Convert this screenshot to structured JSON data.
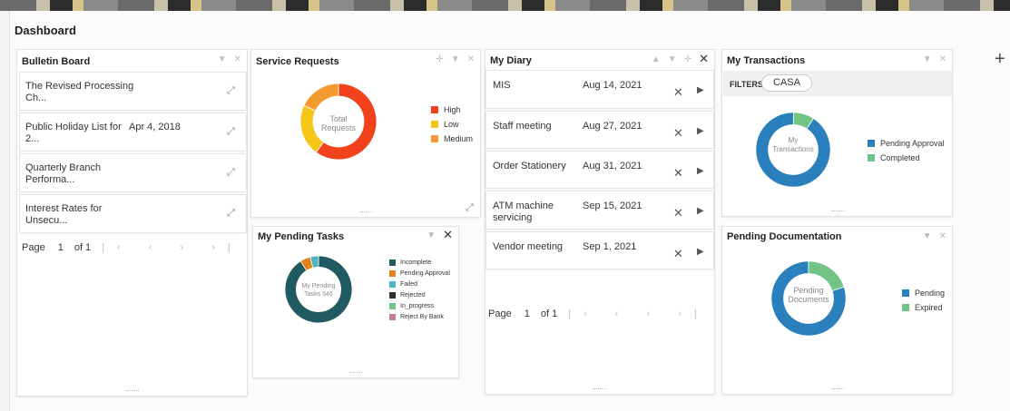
{
  "page": {
    "title": "Dashboard",
    "add_icon": "plus-icon"
  },
  "colors": {
    "high": "#f2421b",
    "low": "#f5c518",
    "medium": "#f49b30",
    "teal": "#205b62",
    "orange": "#e4831c",
    "cyan": "#4cb6c4",
    "blue": "#2a7fbd",
    "green": "#72c386",
    "pink": "#c77f93",
    "black": "#2e2e2e"
  },
  "bulletin": {
    "title": "Bulletin Board",
    "items": [
      {
        "text": "The Revised Processing Ch...",
        "date": ""
      },
      {
        "text": "Public Holiday List for 2...",
        "date": "Apr 4, 2018"
      },
      {
        "text": "Quarterly Branch Performa...",
        "date": ""
      },
      {
        "text": "Interest Rates for Unsecu...",
        "date": ""
      }
    ],
    "pager": {
      "label": "Page",
      "current": "1",
      "of": "of 1"
    }
  },
  "service": {
    "title": "Service Requests",
    "center_label": "Total Requests",
    "legend": [
      "High",
      "Low",
      "Medium"
    ]
  },
  "pending_tasks": {
    "title": "My Pending Tasks",
    "center_label": "My Pending Tasks 546",
    "legend": [
      "Incomplete",
      "Pending Approval",
      "Failed",
      "Rejected",
      "In_progress",
      "Reject By Bank"
    ]
  },
  "diary": {
    "title": "My Diary",
    "rows": [
      {
        "name": "MIS",
        "date": "Aug 14, 2021"
      },
      {
        "name": "Staff meeting",
        "date": "Aug 27, 2021"
      },
      {
        "name": "Order Stationery",
        "date": "Aug 31, 2021"
      },
      {
        "name": "ATM machine servicing",
        "date": "Sep 15, 2021"
      },
      {
        "name": "Vendor meeting",
        "date": "Sep 1, 2021"
      }
    ],
    "pager": {
      "label": "Page",
      "current": "1",
      "of": "of 1"
    }
  },
  "transactions": {
    "title": "My Transactions",
    "filters_label": "FILTERS",
    "filter_value": "CASA",
    "center_label": "My Transactions",
    "legend": [
      "Pending Approval",
      "Completed"
    ]
  },
  "documentation": {
    "title": "Pending Documentation",
    "center_label": "Pending Documents",
    "legend": [
      "Pending",
      "Expired"
    ]
  },
  "chart_data": [
    {
      "type": "pie",
      "title": "Service Requests",
      "categories": [
        "High",
        "Low",
        "Medium"
      ],
      "values": [
        60,
        22,
        18
      ]
    },
    {
      "type": "pie",
      "title": "My Pending Tasks",
      "categories": [
        "Incomplete",
        "Pending Approval",
        "Failed",
        "Rejected",
        "In_progress",
        "Reject By Bank"
      ],
      "values": [
        91,
        5,
        4,
        0,
        0,
        0
      ]
    },
    {
      "type": "pie",
      "title": "My Transactions",
      "categories": [
        "Pending Approval",
        "Completed"
      ],
      "values": [
        91,
        9
      ]
    },
    {
      "type": "pie",
      "title": "Pending Documentation",
      "categories": [
        "Pending",
        "Expired"
      ],
      "values": [
        80,
        20
      ]
    }
  ]
}
